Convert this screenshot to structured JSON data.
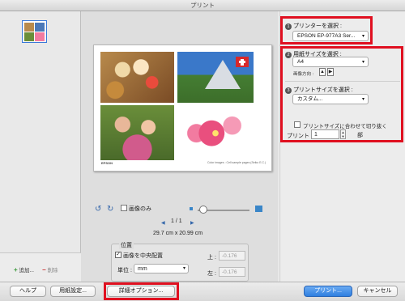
{
  "window": {
    "title": "プリント"
  },
  "sidebar": {
    "add_label": "追加...",
    "remove_label": "削除"
  },
  "preview": {
    "epson_mark": "EPSON",
    "credit_line": "Color images : Cell sample pages (Seiko E.C.)",
    "rotate_left_icon": "rotate-left-icon",
    "rotate_right_icon": "rotate-right-icon",
    "image_only_label": "画像のみ",
    "page_indicator": "1 / 1",
    "paper_dimensions": "29.7 cm x 20.99 cm",
    "position": {
      "title": "位置",
      "center_label": "画像を中央配置",
      "center_checked": true,
      "unit_label": "単位 :",
      "unit_value": "mm",
      "top_label": "上 :",
      "top_value": "-0.176",
      "left_label": "左 :",
      "left_value": "-0.176"
    }
  },
  "settings": {
    "printer": {
      "num": "1",
      "title": "プリンターを選択 :",
      "value": "EPSON EP-977A3 Ser..."
    },
    "paper": {
      "num": "2",
      "title": "用紙サイズを選択 :",
      "value": "A4",
      "orientation_label": "画像方向 :"
    },
    "print_size": {
      "num": "3",
      "title": "プリントサイズを選択 :",
      "value": "カスタム...",
      "fit_label": "プリントサイズに合わせて切り抜く",
      "fit_checked": false
    },
    "copies": {
      "label": "プリント",
      "value": "1",
      "unit": "部"
    }
  },
  "footer": {
    "help": "ヘルプ",
    "page_setup": "用紙設定...",
    "details": "詳細オプション...",
    "print": "プリント...",
    "cancel": "キャンセル"
  },
  "colors": {
    "highlight": "#e01020",
    "accent": "#3a86c8"
  }
}
